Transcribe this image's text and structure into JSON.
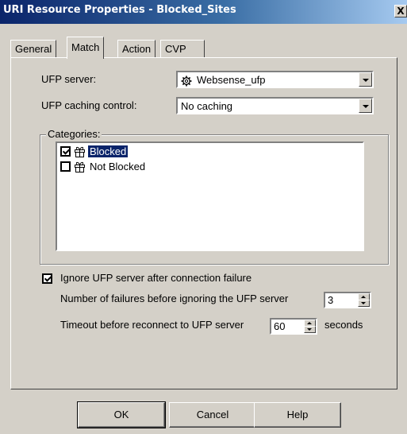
{
  "window": {
    "title": "URI Resource Properties - Blocked_Sites",
    "close_label": "X"
  },
  "tabs": [
    {
      "label": "General",
      "active": false
    },
    {
      "label": "Match",
      "active": true
    },
    {
      "label": "Action",
      "active": false
    },
    {
      "label": "CVP",
      "active": false
    }
  ],
  "match": {
    "ufp_server_label": "UFP server:",
    "ufp_server_value": "Websense_ufp",
    "ufp_server_icon": "gear-icon",
    "ufp_caching_label": "UFP caching control:",
    "ufp_caching_value": "No caching",
    "categories_label": "Categories:",
    "categories": [
      {
        "label": "Blocked",
        "checked": true,
        "selected": true,
        "icon": "gift-icon"
      },
      {
        "label": "Not Blocked",
        "checked": false,
        "selected": false,
        "icon": "gift-icon"
      }
    ],
    "ignore_label": "Ignore UFP server after connection failure",
    "ignore_checked": true,
    "failures_label": "Number of failures before ignoring the UFP server",
    "failures_value": "3",
    "timeout_label": "Timeout before reconnect to UFP server",
    "timeout_value": "60",
    "timeout_unit": "seconds"
  },
  "buttons": {
    "ok": "OK",
    "cancel": "Cancel",
    "help": "Help"
  },
  "colors": {
    "face": "#d4d0c8",
    "title_start": "#0a246a",
    "selection": "#0a246a"
  }
}
